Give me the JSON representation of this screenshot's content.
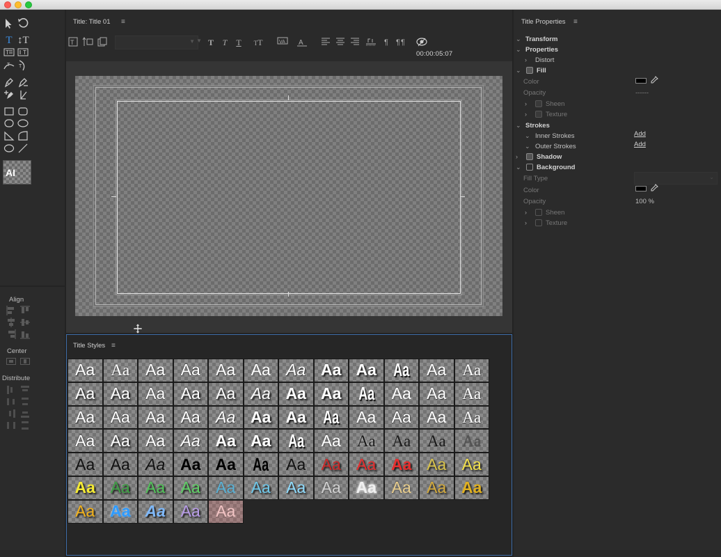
{
  "window": {
    "title_bar": ""
  },
  "designer": {
    "title": "Title: Title 01",
    "timecode": "00:00:05:07",
    "font_family_value": "",
    "font_style_value": ""
  },
  "tools": [
    "selection-tool",
    "rotation-tool",
    "type-tool",
    "vertical-type-tool",
    "area-type-tool",
    "vertical-area-type-tool",
    "path-type-tool",
    "vertical-path-type-tool",
    "pen-tool",
    "delete-anchor-tool",
    "add-anchor-tool",
    "convert-anchor-tool",
    "rectangle-tool",
    "rounded-rectangle-tool",
    "ellipse-tool",
    "rounded-corner-rect-tool",
    "wedge-tool",
    "arc-tool",
    "ellipse2-tool",
    "line-tool"
  ],
  "actions": {
    "align_label": "Align",
    "center_label": "Center",
    "distribute_label": "Distribute"
  },
  "styles_panel": {
    "title": "Title Styles"
  },
  "title_styles": [
    {
      "label": "Aa",
      "color": "#ffffff",
      "font": "sans",
      "weight": "normal",
      "style": "normal",
      "effect": "shadow"
    },
    {
      "label": "Aa",
      "color": "#ffffff",
      "font": "serif",
      "weight": "normal",
      "style": "normal",
      "effect": "shadow"
    },
    {
      "label": "Aa",
      "color": "#ffffff",
      "font": "sans",
      "weight": "normal",
      "style": "normal",
      "effect": "shadow"
    },
    {
      "label": "Aa",
      "color": "#ffffff",
      "font": "sans",
      "weight": "normal",
      "style": "normal",
      "effect": "outline-thin"
    },
    {
      "label": "Aa",
      "color": "#ffffff",
      "font": "sans",
      "weight": "normal",
      "style": "normal",
      "effect": "shadow"
    },
    {
      "label": "Aa",
      "color": "#ffffff",
      "font": "sans",
      "weight": "normal",
      "style": "normal",
      "effect": "soft"
    },
    {
      "label": "Aa",
      "color": "#ffffff",
      "font": "sans",
      "weight": "normal",
      "style": "italic",
      "effect": "shadow"
    },
    {
      "label": "Aa",
      "color": "#ffffff",
      "font": "sans",
      "weight": "bold",
      "style": "normal",
      "effect": "dark-shadow"
    },
    {
      "label": "Aa",
      "color": "#ffffff",
      "font": "sans",
      "weight": "bold",
      "style": "normal",
      "effect": "dark-shadow"
    },
    {
      "label": "Aa",
      "color": "#ffffff",
      "font": "sans",
      "weight": "bold",
      "style": "normal",
      "effect": "condensed"
    },
    {
      "label": "Aa",
      "color": "#ffffff",
      "font": "sans",
      "weight": "normal",
      "style": "normal",
      "effect": "shadow"
    },
    {
      "label": "Aa",
      "color": "#ffffff",
      "font": "serif",
      "weight": "normal",
      "style": "normal",
      "effect": "shadow"
    },
    {
      "label": "Aa",
      "color": "#ffffff",
      "font": "sans",
      "weight": "normal",
      "style": "normal",
      "effect": "dark-shadow"
    },
    {
      "label": "Aa",
      "color": "#ffffff",
      "font": "sans",
      "weight": "normal",
      "style": "normal",
      "effect": "dark-shadow"
    },
    {
      "label": "Aa",
      "color": "#ffffff",
      "font": "sans",
      "weight": "normal",
      "style": "normal",
      "effect": "outline-thin"
    },
    {
      "label": "Aa",
      "color": "#ffffff",
      "font": "sans",
      "weight": "normal",
      "style": "normal",
      "effect": "dark-shadow"
    },
    {
      "label": "Aa",
      "color": "#ffffff",
      "font": "sans",
      "weight": "normal",
      "style": "normal",
      "effect": "dark-shadow"
    },
    {
      "label": "Aa",
      "color": "#ffffff",
      "font": "sans",
      "weight": "normal",
      "style": "italic",
      "effect": "dark-shadow"
    },
    {
      "label": "Aa",
      "color": "#ffffff",
      "font": "sans",
      "weight": "bold",
      "style": "normal",
      "effect": "dark-shadow"
    },
    {
      "label": "Aa",
      "color": "#ffffff",
      "font": "sans",
      "weight": "bold",
      "style": "normal",
      "effect": "dark-shadow"
    },
    {
      "label": "Aa",
      "color": "#ffffff",
      "font": "sans",
      "weight": "bold",
      "style": "normal",
      "effect": "condensed"
    },
    {
      "label": "Aa",
      "color": "#ffffff",
      "font": "sans",
      "weight": "normal",
      "style": "normal",
      "effect": "soft"
    },
    {
      "label": "Aa",
      "color": "#ffffff",
      "font": "sans",
      "weight": "normal",
      "style": "normal",
      "effect": "shadow"
    },
    {
      "label": "Aa",
      "color": "#ffffff",
      "font": "serif",
      "weight": "normal",
      "style": "normal",
      "effect": "shadow"
    },
    {
      "label": "Aa",
      "color": "#ffffff",
      "font": "sans",
      "weight": "normal",
      "style": "normal",
      "effect": "shadow"
    },
    {
      "label": "Aa",
      "color": "#ffffff",
      "font": "sans",
      "weight": "normal",
      "style": "normal",
      "effect": "outline-thin"
    },
    {
      "label": "Aa",
      "color": "#ffffff",
      "font": "sans",
      "weight": "normal",
      "style": "normal",
      "effect": "shadow"
    },
    {
      "label": "Aa",
      "color": "#ffffff",
      "font": "sans",
      "weight": "normal",
      "style": "normal",
      "effect": "shadow"
    },
    {
      "label": "Aa",
      "color": "#ffffff",
      "font": "sans",
      "weight": "normal",
      "style": "italic",
      "effect": "shadow"
    },
    {
      "label": "Aa",
      "color": "#ffffff",
      "font": "sans",
      "weight": "bold",
      "style": "normal",
      "effect": "dark-shadow"
    },
    {
      "label": "Aa",
      "color": "#ffffff",
      "font": "sans",
      "weight": "bold",
      "style": "normal",
      "effect": "dark-shadow"
    },
    {
      "label": "Aa",
      "color": "#ffffff",
      "font": "sans",
      "weight": "bold",
      "style": "normal",
      "effect": "condensed"
    },
    {
      "label": "Aa",
      "color": "#ffffff",
      "font": "sans",
      "weight": "normal",
      "style": "normal",
      "effect": "soft"
    },
    {
      "label": "Aa",
      "color": "#ffffff",
      "font": "sans",
      "weight": "normal",
      "style": "normal",
      "effect": "outline-thin"
    },
    {
      "label": "Aa",
      "color": "#ffffff",
      "font": "sans",
      "weight": "normal",
      "style": "normal",
      "effect": "soft"
    },
    {
      "label": "Aa",
      "color": "#ffffff",
      "font": "serif",
      "weight": "normal",
      "style": "normal",
      "effect": "shadow"
    },
    {
      "label": "Aa",
      "color": "#ffffff",
      "font": "sans",
      "weight": "normal",
      "style": "normal",
      "effect": "outline-thin"
    },
    {
      "label": "Aa",
      "color": "#ffffff",
      "font": "sans",
      "weight": "normal",
      "style": "normal",
      "effect": "dark-shadow"
    },
    {
      "label": "Aa",
      "color": "#ffffff",
      "font": "sans",
      "weight": "normal",
      "style": "normal",
      "effect": "shadow"
    },
    {
      "label": "Aa",
      "color": "#ffffff",
      "font": "sans",
      "weight": "normal",
      "style": "italic",
      "effect": "shadow"
    },
    {
      "label": "Aa",
      "color": "#ffffff",
      "font": "sans",
      "weight": "bold",
      "style": "normal",
      "effect": "dark-shadow"
    },
    {
      "label": "Aa",
      "color": "#ffffff",
      "font": "sans",
      "weight": "bold",
      "style": "normal",
      "effect": "dark-shadow"
    },
    {
      "label": "Aa",
      "color": "#ffffff",
      "font": "sans",
      "weight": "bold",
      "style": "normal",
      "effect": "condensed"
    },
    {
      "label": "Aa",
      "color": "#ffffff",
      "font": "sans",
      "weight": "normal",
      "style": "normal",
      "effect": "soft"
    },
    {
      "label": "Aa",
      "color": "#1a1a1a",
      "font": "serif",
      "weight": "normal",
      "style": "normal",
      "effect": "light-glow"
    },
    {
      "label": "Aa",
      "color": "#1a1a1a",
      "font": "serif",
      "weight": "normal",
      "style": "normal",
      "effect": "none"
    },
    {
      "label": "Aa",
      "color": "#1a1a1a",
      "font": "serif",
      "weight": "normal",
      "style": "normal",
      "effect": "none"
    },
    {
      "label": "Aa",
      "color": "#555555",
      "font": "serif",
      "weight": "normal",
      "style": "normal",
      "effect": "outline-dark"
    },
    {
      "label": "Aa",
      "color": "#111111",
      "font": "sans",
      "weight": "normal",
      "style": "normal",
      "effect": "none"
    },
    {
      "label": "Aa",
      "color": "#111111",
      "font": "sans",
      "weight": "normal",
      "style": "normal",
      "effect": "none"
    },
    {
      "label": "Aa",
      "color": "#111111",
      "font": "sans",
      "weight": "normal",
      "style": "italic",
      "effect": "none"
    },
    {
      "label": "Aa",
      "color": "#000000",
      "font": "sans",
      "weight": "bold",
      "style": "normal",
      "effect": "none"
    },
    {
      "label": "Aa",
      "color": "#000000",
      "font": "sans",
      "weight": "bold",
      "style": "normal",
      "effect": "none"
    },
    {
      "label": "Aa",
      "color": "#000000",
      "font": "sans",
      "weight": "bold",
      "style": "normal",
      "effect": "condensed-dark"
    },
    {
      "label": "Aa",
      "color": "#111111",
      "font": "sans",
      "weight": "normal",
      "style": "normal",
      "effect": "none"
    },
    {
      "label": "Aa",
      "color": "#c82828",
      "font": "sans",
      "weight": "normal",
      "style": "normal",
      "effect": "dark-shadow"
    },
    {
      "label": "Aa",
      "color": "#e52e2e",
      "font": "sans",
      "weight": "normal",
      "style": "normal",
      "effect": "dark-shadow"
    },
    {
      "label": "Aa",
      "color": "#e52e2e",
      "font": "sans",
      "weight": "bold",
      "style": "normal",
      "effect": "dark-shadow"
    },
    {
      "label": "Aa",
      "color": "#d8c24a",
      "font": "sans",
      "weight": "normal",
      "style": "normal",
      "effect": "dark-shadow"
    },
    {
      "label": "Aa",
      "color": "#f2e04a",
      "font": "sans",
      "weight": "normal",
      "style": "normal",
      "effect": "dark-shadow"
    },
    {
      "label": "Aa",
      "color": "#f4ea34",
      "font": "sans",
      "weight": "bold",
      "style": "normal",
      "effect": "dark-shadow"
    },
    {
      "label": "Aa",
      "color": "#3fa046",
      "font": "sans",
      "weight": "normal",
      "style": "normal",
      "effect": "dark-shadow"
    },
    {
      "label": "Aa",
      "color": "#52c45a",
      "font": "sans",
      "weight": "normal",
      "style": "normal",
      "effect": "dark-shadow"
    },
    {
      "label": "Aa",
      "color": "#5fd066",
      "font": "sans",
      "weight": "normal",
      "style": "normal",
      "effect": "dark-shadow"
    },
    {
      "label": "Aa",
      "color": "#5ab2d6",
      "font": "sans",
      "weight": "normal",
      "style": "normal",
      "effect": "soft"
    },
    {
      "label": "Aa",
      "color": "#6ec8ea",
      "font": "sans",
      "weight": "normal",
      "style": "normal",
      "effect": "dark-shadow"
    },
    {
      "label": "Aa",
      "color": "#8fdcff",
      "font": "sans",
      "weight": "normal",
      "style": "normal",
      "effect": "dark-shadow"
    },
    {
      "label": "Aa",
      "color": "#d0d0d0",
      "font": "sans",
      "weight": "normal",
      "style": "normal",
      "effect": "soft"
    },
    {
      "label": "Aa",
      "color": "#f0f0f0",
      "font": "sans",
      "weight": "bold",
      "style": "normal",
      "effect": "glow"
    },
    {
      "label": "Aa",
      "color": "#e8cd8c",
      "font": "sans",
      "weight": "normal",
      "style": "normal",
      "effect": "soft"
    },
    {
      "label": "Aa",
      "color": "#d4aa3c",
      "font": "sans",
      "weight": "normal",
      "style": "normal",
      "effect": "dark-shadow"
    },
    {
      "label": "Aa",
      "color": "#e0b020",
      "font": "sans",
      "weight": "bold",
      "style": "normal",
      "effect": "dark-shadow"
    },
    {
      "label": "Aa",
      "color": "#f3b21a",
      "font": "sans",
      "weight": "normal",
      "style": "normal",
      "effect": "dark-shadow"
    },
    {
      "label": "Aa",
      "color": "#2e9bff",
      "font": "sans",
      "weight": "bold",
      "style": "normal",
      "effect": "glow-blue"
    },
    {
      "label": "Aa",
      "color": "#7fb8f8",
      "font": "sans",
      "weight": "bold",
      "style": "italic",
      "effect": "dark-shadow"
    },
    {
      "label": "Aa",
      "color": "#b89ce8",
      "font": "sans",
      "weight": "normal",
      "style": "normal",
      "effect": "dark-shadow"
    },
    {
      "label": "Aa",
      "color": "#f2c4c4",
      "font": "sans",
      "weight": "normal",
      "style": "normal",
      "effect": "pink-bg"
    }
  ],
  "properties": {
    "title": "Title Properties",
    "transform": "Transform",
    "properties": "Properties",
    "distort": "Distort",
    "fill": "Fill",
    "color": "Color",
    "opacity": "Opacity",
    "opacity_value": "------",
    "sheen": "Sheen",
    "texture": "Texture",
    "strokes": "Strokes",
    "inner_strokes": "Inner Strokes",
    "outer_strokes": "Outer Strokes",
    "add": "Add",
    "shadow": "Shadow",
    "background": "Background",
    "fill_type": "Fill Type",
    "bg_color": "Color",
    "bg_opacity": "Opacity",
    "bg_opacity_value": "100 %",
    "bg_sheen": "Sheen",
    "bg_texture": "Texture",
    "fill_color": "#000000",
    "bg_color_value": "#000000"
  }
}
